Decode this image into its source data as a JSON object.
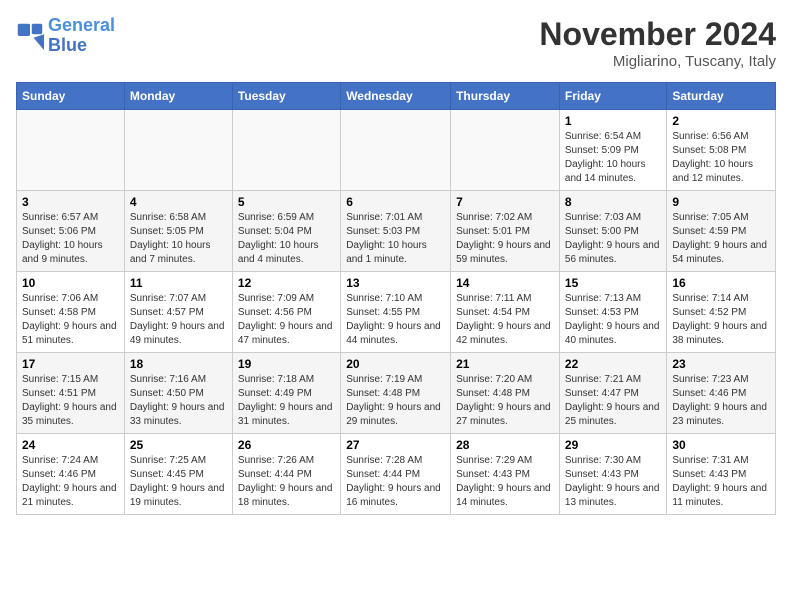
{
  "header": {
    "logo_line1": "General",
    "logo_line2": "Blue",
    "month": "November 2024",
    "location": "Migliarino, Tuscany, Italy"
  },
  "columns": [
    "Sunday",
    "Monday",
    "Tuesday",
    "Wednesday",
    "Thursday",
    "Friday",
    "Saturday"
  ],
  "weeks": [
    [
      {
        "day": "",
        "info": ""
      },
      {
        "day": "",
        "info": ""
      },
      {
        "day": "",
        "info": ""
      },
      {
        "day": "",
        "info": ""
      },
      {
        "day": "",
        "info": ""
      },
      {
        "day": "1",
        "info": "Sunrise: 6:54 AM\nSunset: 5:09 PM\nDaylight: 10 hours and 14 minutes."
      },
      {
        "day": "2",
        "info": "Sunrise: 6:56 AM\nSunset: 5:08 PM\nDaylight: 10 hours and 12 minutes."
      }
    ],
    [
      {
        "day": "3",
        "info": "Sunrise: 6:57 AM\nSunset: 5:06 PM\nDaylight: 10 hours and 9 minutes."
      },
      {
        "day": "4",
        "info": "Sunrise: 6:58 AM\nSunset: 5:05 PM\nDaylight: 10 hours and 7 minutes."
      },
      {
        "day": "5",
        "info": "Sunrise: 6:59 AM\nSunset: 5:04 PM\nDaylight: 10 hours and 4 minutes."
      },
      {
        "day": "6",
        "info": "Sunrise: 7:01 AM\nSunset: 5:03 PM\nDaylight: 10 hours and 1 minute."
      },
      {
        "day": "7",
        "info": "Sunrise: 7:02 AM\nSunset: 5:01 PM\nDaylight: 9 hours and 59 minutes."
      },
      {
        "day": "8",
        "info": "Sunrise: 7:03 AM\nSunset: 5:00 PM\nDaylight: 9 hours and 56 minutes."
      },
      {
        "day": "9",
        "info": "Sunrise: 7:05 AM\nSunset: 4:59 PM\nDaylight: 9 hours and 54 minutes."
      }
    ],
    [
      {
        "day": "10",
        "info": "Sunrise: 7:06 AM\nSunset: 4:58 PM\nDaylight: 9 hours and 51 minutes."
      },
      {
        "day": "11",
        "info": "Sunrise: 7:07 AM\nSunset: 4:57 PM\nDaylight: 9 hours and 49 minutes."
      },
      {
        "day": "12",
        "info": "Sunrise: 7:09 AM\nSunset: 4:56 PM\nDaylight: 9 hours and 47 minutes."
      },
      {
        "day": "13",
        "info": "Sunrise: 7:10 AM\nSunset: 4:55 PM\nDaylight: 9 hours and 44 minutes."
      },
      {
        "day": "14",
        "info": "Sunrise: 7:11 AM\nSunset: 4:54 PM\nDaylight: 9 hours and 42 minutes."
      },
      {
        "day": "15",
        "info": "Sunrise: 7:13 AM\nSunset: 4:53 PM\nDaylight: 9 hours and 40 minutes."
      },
      {
        "day": "16",
        "info": "Sunrise: 7:14 AM\nSunset: 4:52 PM\nDaylight: 9 hours and 38 minutes."
      }
    ],
    [
      {
        "day": "17",
        "info": "Sunrise: 7:15 AM\nSunset: 4:51 PM\nDaylight: 9 hours and 35 minutes."
      },
      {
        "day": "18",
        "info": "Sunrise: 7:16 AM\nSunset: 4:50 PM\nDaylight: 9 hours and 33 minutes."
      },
      {
        "day": "19",
        "info": "Sunrise: 7:18 AM\nSunset: 4:49 PM\nDaylight: 9 hours and 31 minutes."
      },
      {
        "day": "20",
        "info": "Sunrise: 7:19 AM\nSunset: 4:48 PM\nDaylight: 9 hours and 29 minutes."
      },
      {
        "day": "21",
        "info": "Sunrise: 7:20 AM\nSunset: 4:48 PM\nDaylight: 9 hours and 27 minutes."
      },
      {
        "day": "22",
        "info": "Sunrise: 7:21 AM\nSunset: 4:47 PM\nDaylight: 9 hours and 25 minutes."
      },
      {
        "day": "23",
        "info": "Sunrise: 7:23 AM\nSunset: 4:46 PM\nDaylight: 9 hours and 23 minutes."
      }
    ],
    [
      {
        "day": "24",
        "info": "Sunrise: 7:24 AM\nSunset: 4:46 PM\nDaylight: 9 hours and 21 minutes."
      },
      {
        "day": "25",
        "info": "Sunrise: 7:25 AM\nSunset: 4:45 PM\nDaylight: 9 hours and 19 minutes."
      },
      {
        "day": "26",
        "info": "Sunrise: 7:26 AM\nSunset: 4:44 PM\nDaylight: 9 hours and 18 minutes."
      },
      {
        "day": "27",
        "info": "Sunrise: 7:28 AM\nSunset: 4:44 PM\nDaylight: 9 hours and 16 minutes."
      },
      {
        "day": "28",
        "info": "Sunrise: 7:29 AM\nSunset: 4:43 PM\nDaylight: 9 hours and 14 minutes."
      },
      {
        "day": "29",
        "info": "Sunrise: 7:30 AM\nSunset: 4:43 PM\nDaylight: 9 hours and 13 minutes."
      },
      {
        "day": "30",
        "info": "Sunrise: 7:31 AM\nSunset: 4:43 PM\nDaylight: 9 hours and 11 minutes."
      }
    ]
  ]
}
